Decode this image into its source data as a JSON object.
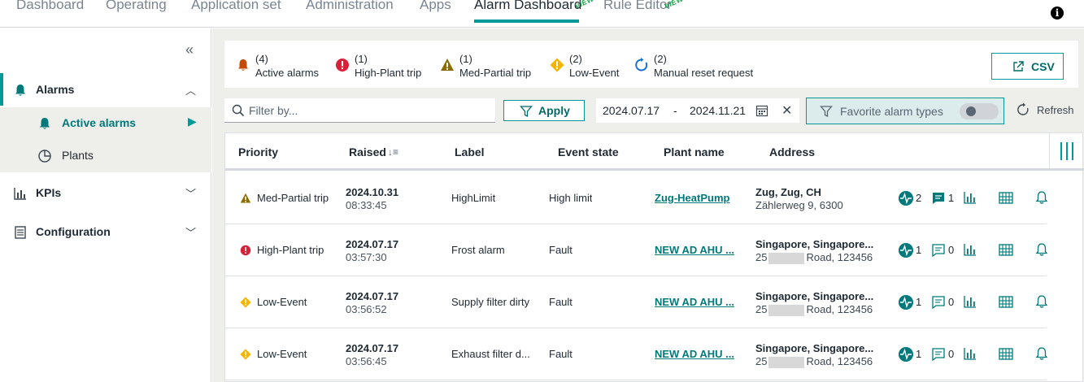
{
  "topnav": {
    "tabs": [
      "Dashboard",
      "Operating",
      "Application set",
      "Administration",
      "Apps",
      "Alarm Dashboard",
      "Rule Editor"
    ],
    "preview_tag": "VIEW"
  },
  "sidebar": {
    "items": [
      {
        "label": "Alarms"
      },
      {
        "label": "KPIs"
      },
      {
        "label": "Configuration"
      }
    ],
    "subitems": [
      {
        "label": "Active alarms"
      },
      {
        "label": "Plants"
      }
    ]
  },
  "summary": {
    "stats": [
      {
        "count": "(4)",
        "label": "Active alarms"
      },
      {
        "count": "(1)",
        "label": "High-Plant trip"
      },
      {
        "count": "(1)",
        "label": "Med-Partial trip"
      },
      {
        "count": "(2)",
        "label": "Low-Event"
      },
      {
        "count": "(2)",
        "label": "Manual reset request"
      }
    ],
    "csv_label": "CSV"
  },
  "filters": {
    "filter_placeholder": "Filter by...",
    "apply_label": "Apply",
    "date_from": "2024.07.17",
    "date_sep": "-",
    "date_to": "2024.11.21",
    "favorite_label": "Favorite alarm types",
    "refresh_label": "Refresh"
  },
  "table": {
    "headers": [
      "Priority",
      "Raised",
      "Label",
      "Event state",
      "Plant name",
      "Address"
    ],
    "rows": [
      {
        "priority": "Med-Partial trip",
        "date": "2024.10.31",
        "time": "08:33:45",
        "label": "HighLimit",
        "state": "High limit",
        "plant": "Zug-HeatPump",
        "addr1": "Zug, Zug, CH",
        "addr2": "Zählerweg 9, 6300",
        "addr2_pre": "",
        "addr2_post": "",
        "trend_count": "2",
        "comment_count": "1"
      },
      {
        "priority": "High-Plant trip",
        "date": "2024.07.17",
        "time": "03:57:30",
        "label": "Frost alarm",
        "state": "Fault",
        "plant": "NEW AD AHU ...",
        "addr1": "Singapore, Singapore...",
        "addr2": "",
        "addr2_pre": "25",
        "addr2_post": "Road, 123456",
        "trend_count": "1",
        "comment_count": "0"
      },
      {
        "priority": "Low-Event",
        "date": "2024.07.17",
        "time": "03:56:52",
        "label": "Supply filter dirty",
        "state": "Fault",
        "plant": "NEW AD AHU ...",
        "addr1": "Singapore, Singapore...",
        "addr2": "",
        "addr2_pre": "25",
        "addr2_post": "Road, 123456",
        "trend_count": "1",
        "comment_count": "0"
      },
      {
        "priority": "Low-Event",
        "date": "2024.07.17",
        "time": "03:56:45",
        "label": "Exhaust filter d...",
        "state": "Fault",
        "plant": "NEW AD AHU ...",
        "addr1": "Singapore, Singapore...",
        "addr2": "",
        "addr2_pre": "25",
        "addr2_post": "Road, 123456",
        "trend_count": "1",
        "comment_count": "0"
      }
    ]
  },
  "colors": {
    "accent": "#009999",
    "high": "#d72339",
    "med": "#8a6d00",
    "low": "#f5b400",
    "alarm_bell": "#c44b00"
  }
}
